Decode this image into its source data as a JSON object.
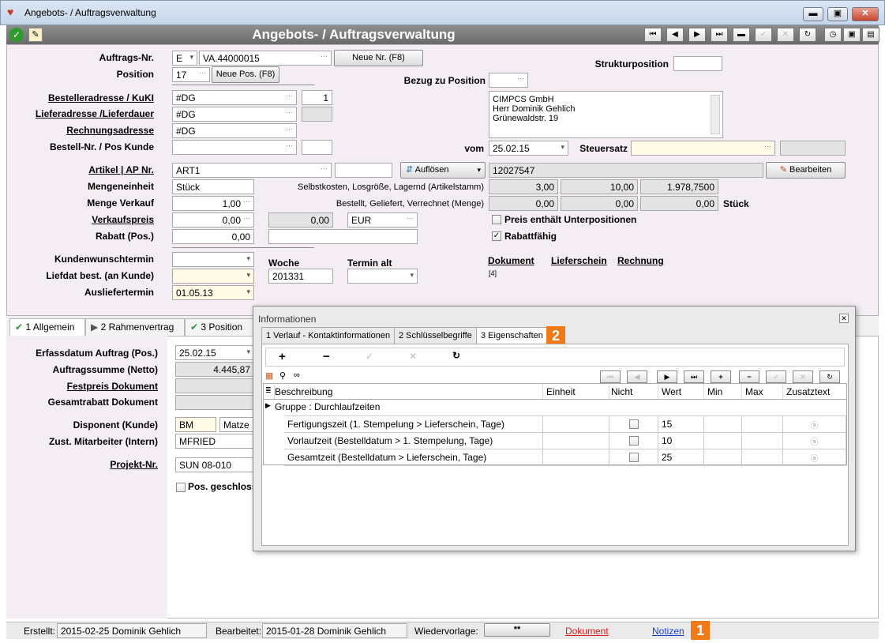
{
  "window": {
    "title": "Angebots- / Auftragsverwaltung",
    "min": "▬",
    "max": "▣",
    "close": "✕"
  },
  "header": {
    "title": "Angebots- / Auftragsverwaltung",
    "nav": [
      "⏮",
      "◀",
      "▶",
      "⏭",
      "▬",
      "✓",
      "✕",
      "↻"
    ]
  },
  "form": {
    "auftrags_nr_label": "Auftrags-Nr.",
    "auftrags_prefix": "E",
    "auftrags_nr": "VA.44000015",
    "neue_nr": "Neue Nr. (F8)",
    "position_label": "Position",
    "position": "17",
    "neue_pos": "Neue Pos. (F8)",
    "bezug_label": "Bezug zu Position",
    "struktur_label": "Strukturposition",
    "besteller_label": "Bestelleradresse / KuKI",
    "besteller": "#DG",
    "besteller_num": "1",
    "liefer_label": "Lieferadresse /Lieferdauer",
    "liefer": "#DG",
    "rechnung_label": "Rechnungsadresse",
    "rechnung": "#DG",
    "bestellnr_label": "Bestell-Nr. / Pos Kunde",
    "address": [
      "CIMPCS GmbH",
      "Herr Dominik Gehlich",
      "Grünewaldstr. 19"
    ],
    "vom_label": "vom",
    "vom": "25.02.15",
    "steuersatz_label": "Steuersatz",
    "artikel_label": "Artikel | AP Nr.",
    "artikel": "ART1",
    "aufloesen": "Auflösen",
    "artikel_code": "12027547",
    "bearbeiten": "Bearbeiten",
    "mengeneinheit_label": "Mengeneinheit",
    "mengeneinheit": "Stück",
    "selbstkosten_label": "Selbstkosten, Losgröße, Lagernd (Artikelstamm)",
    "selbstkosten": [
      "3,00",
      "10,00",
      "1.978,7500"
    ],
    "menge_label": "Menge Verkauf",
    "menge": "1,00",
    "bestellt_label": "Bestellt, Geliefert, Verrechnet (Menge)",
    "bestellt": [
      "0,00",
      "0,00",
      "0,00"
    ],
    "stueck": "Stück",
    "vk_label": "Verkaufspreis",
    "vk": "0,00",
    "vk2": "0,00",
    "waehrung": "EUR",
    "preis_unterpos": "Preis enthält Unterpositionen",
    "rabatt_label": "Rabatt (Pos.)",
    "rabatt": "0,00",
    "rabattfaehig": "Rabattfähig",
    "kwt_label": "Kundenwunschtermin",
    "woche_label": "Woche",
    "termin_alt_label": "Termin alt",
    "liefdat_label": "Liefdat best. (an Kunde)",
    "woche": "201331",
    "auslief_label": "Ausliefertermin",
    "auslief": "01.05.13",
    "dokument": "Dokument",
    "lieferschein": "Lieferschein",
    "rechnung_link": "Rechnung",
    "doc_count": "[4]"
  },
  "tabs": [
    {
      "label": "1 Allgemein"
    },
    {
      "label": "2 Rahmenvertrag"
    },
    {
      "label": "3 Position"
    }
  ],
  "lower": {
    "erfass_label": "Erfassdatum Auftrag (Pos.)",
    "erfass": "25.02.15",
    "summe_label": "Auftragssumme (Netto)",
    "summe": "4.445,87",
    "festpreis_label": "Festpreis Dokument",
    "gesamtrabatt_label": "Gesamtrabatt Dokument",
    "disponent_label": "Disponent (Kunde)",
    "disponent": "BM",
    "disponent_name": "Matze B",
    "mitarbeiter_label": "Zust. Mitarbeiter (Intern)",
    "mitarbeiter": "MFRIED",
    "projekt_label": "Projekt-Nr.",
    "projekt": "SUN 08-010",
    "geschlossen": "Pos. geschloss"
  },
  "dialog": {
    "title": "Informationen",
    "tabs": [
      "1 Verlauf - Kontaktinformationen",
      "2 Schlüsselbegriffe",
      "3 Eigenschaften"
    ],
    "columns": [
      "Beschreibung",
      "Einheit",
      "Nicht",
      "Wert",
      "Min",
      "Max",
      "Zusatztext"
    ],
    "group": "Gruppe : Durchlaufzeiten",
    "rows": [
      {
        "beschreibung": "Fertigungszeit (1. Stempelung > Lieferschein, Tage)",
        "wert": "15"
      },
      {
        "beschreibung": "Vorlaufzeit (Bestelldatum > 1. Stempelung, Tage)",
        "wert": "10"
      },
      {
        "beschreibung": "Gesamtzeit (Bestelldatum > Lieferschein, Tage)",
        "wert": "25"
      }
    ],
    "badge": "2"
  },
  "status": {
    "erstellt_label": "Erstellt:",
    "erstellt": "2015-02-25  Dominik Gehlich",
    "bearbeitet_label": "Bearbeitet:",
    "bearbeitet": "2015-01-28  Dominik Gehlich",
    "wiedervorlage_label": "Wiedervorlage:",
    "wiedervorlage": "**",
    "dokument": "Dokument",
    "notizen": "Notizen",
    "badge": "1"
  },
  "colors": {
    "accent": "#f27a16",
    "header": "#7a7a7a",
    "form_bg": "#f4eef4",
    "link_red": "#d42020",
    "link_blue": "#1a3fd0"
  }
}
